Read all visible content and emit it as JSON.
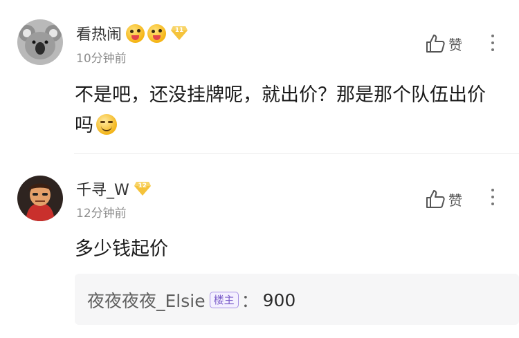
{
  "comments": [
    {
      "username": "看热闹",
      "emoji_icons": [
        "tongue-wink-emoji",
        "tongue-wink-emoji"
      ],
      "level": "11",
      "time": "10分钟前",
      "like_label": "赞",
      "text": "不是吧，还没挂牌呢，就出价？那是那个队伍出价吗"
    },
    {
      "username": "千寻_W",
      "level": "12",
      "time": "12分钟前",
      "like_label": "赞",
      "text": "多少钱起价",
      "reply": {
        "author": "夜夜夜夜_Elsie",
        "badge": "楼主",
        "separator": "：",
        "text": "900"
      }
    }
  ],
  "colors": {
    "level_badge": "#f5c33b",
    "op_badge": "#7a5cc8",
    "time": "#8c8c8c"
  }
}
